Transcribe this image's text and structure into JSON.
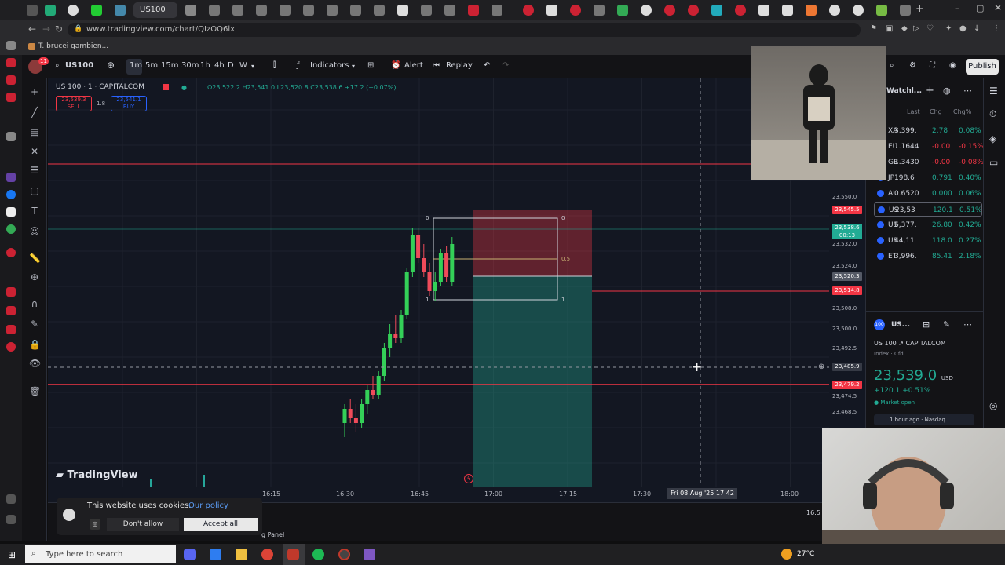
{
  "browser": {
    "active_tab": "US100",
    "url": "www.tradingview.com/chart/QIzOQ6lx",
    "bookmark": "T. brucei gambien..."
  },
  "header": {
    "avatar_badge": "11",
    "symbol": "US100",
    "intervals": [
      "1m",
      "5m",
      "15m",
      "30m",
      "1h",
      "4h",
      "D",
      "W"
    ],
    "indicators": "Indicators",
    "alert": "Alert",
    "replay": "Replay",
    "publish": "Publish"
  },
  "legend": {
    "title": "US 100 · 1 · CAPITALCOM",
    "ohlc": "O23,522.2 H23,541.0 L23,520.8 C23,538.6 +17.2 (+0.07%)",
    "sell_price": "23,539.3",
    "sell_label": "SELL",
    "spread": "1.8",
    "buy_price": "23,541.1",
    "buy_label": "BUY"
  },
  "chart": {
    "price_ticks": [
      "23,550.0",
      "23,532.0",
      "23,524.0",
      "23,508.0",
      "23,500.0",
      "23,492.5",
      "23,474.5",
      "23,468.5"
    ],
    "price_labels": [
      {
        "text": "23,545.5",
        "color": "#f23645"
      },
      {
        "text": "23,538.6",
        "color": "#22ab94"
      },
      {
        "text": "23,520.3",
        "color": "#555a66"
      },
      {
        "text": "23,514.8",
        "color": "#f23645"
      },
      {
        "text": "23,485.9",
        "color": "#363a45"
      },
      {
        "text": "23,479.2",
        "color": "#f23645"
      }
    ],
    "countdown": "00:13",
    "time_ticks": [
      "16:15",
      "16:30",
      "16:45",
      "17:00",
      "17:15",
      "17:30",
      "18:00"
    ],
    "crosshair_time": "Fri 08 Aug '25  17:42",
    "fib_top": "0",
    "fib_mid": "0.5",
    "fib_bottom": "1",
    "fib_top_left": "0",
    "fib_bottom_left": "1",
    "logo": "TradingView",
    "right_clock": "16:5"
  },
  "chart_data": {
    "type": "candlestick",
    "ylim": [
      23460,
      23560
    ],
    "candles": [
      {
        "o": 23462,
        "h": 23470,
        "l": 23456,
        "c": 23468
      },
      {
        "o": 23468,
        "h": 23472,
        "l": 23462,
        "c": 23464
      },
      {
        "o": 23464,
        "h": 23470,
        "l": 23458,
        "c": 23462
      },
      {
        "o": 23462,
        "h": 23472,
        "l": 23460,
        "c": 23470
      },
      {
        "o": 23470,
        "h": 23478,
        "l": 23466,
        "c": 23476
      },
      {
        "o": 23476,
        "h": 23482,
        "l": 23472,
        "c": 23474
      },
      {
        "o": 23474,
        "h": 23484,
        "l": 23472,
        "c": 23482
      },
      {
        "o": 23482,
        "h": 23496,
        "l": 23480,
        "c": 23494
      },
      {
        "o": 23494,
        "h": 23504,
        "l": 23490,
        "c": 23500
      },
      {
        "o": 23500,
        "h": 23508,
        "l": 23496,
        "c": 23498
      },
      {
        "o": 23498,
        "h": 23510,
        "l": 23496,
        "c": 23508
      },
      {
        "o": 23508,
        "h": 23528,
        "l": 23506,
        "c": 23526
      },
      {
        "o": 23526,
        "h": 23545,
        "l": 23524,
        "c": 23542
      },
      {
        "o": 23542,
        "h": 23545,
        "l": 23530,
        "c": 23532
      },
      {
        "o": 23532,
        "h": 23538,
        "l": 23524,
        "c": 23526
      },
      {
        "o": 23526,
        "h": 23530,
        "l": 23516,
        "c": 23518
      },
      {
        "o": 23518,
        "h": 23526,
        "l": 23514,
        "c": 23522
      },
      {
        "o": 23522,
        "h": 23536,
        "l": 23520,
        "c": 23534
      },
      {
        "o": 23534,
        "h": 23537,
        "l": 23522,
        "c": 23524
      },
      {
        "o": 23522,
        "h": 23541,
        "l": 23520,
        "c": 23538
      }
    ]
  },
  "watchlist": {
    "title": "Watchl...",
    "columns": [
      "Last",
      "Chg",
      "Chg%"
    ],
    "rows": [
      {
        "sym": "XA",
        "last": "3,399.",
        "chg": "2.78",
        "pct": "0.08%",
        "color": "#22ab94"
      },
      {
        "sym": "EU",
        "last": "1.1644",
        "chg": "-0.00",
        "pct": "-0.15%",
        "color": "#f23645"
      },
      {
        "sym": "GB",
        "last": "1.3430",
        "chg": "-0.00",
        "pct": "-0.08%",
        "color": "#f23645"
      },
      {
        "sym": "JP",
        "last": "198.6",
        "chg": "0.791",
        "pct": "0.40%",
        "color": "#22ab94"
      },
      {
        "sym": "AU",
        "last": "0.6520",
        "chg": "0.000",
        "pct": "0.06%",
        "color": "#22ab94"
      },
      {
        "sym": "US",
        "last": "23,53",
        "chg": "120.1",
        "pct": "0.51%",
        "color": "#22ab94"
      },
      {
        "sym": "US",
        "last": "6,377.",
        "chg": "26.80",
        "pct": "0.42%",
        "color": "#22ab94"
      },
      {
        "sym": "US",
        "last": "44,11",
        "chg": "118.0",
        "pct": "0.27%",
        "color": "#22ab94"
      },
      {
        "sym": "ET",
        "last": "3,996.",
        "chg": "85.41",
        "pct": "2.18%",
        "color": "#22ab94"
      }
    ]
  },
  "details": {
    "short": "US...",
    "name": "US 100",
    "exchange": "CAPITALCOM",
    "type": "Index · Cfd",
    "price": "23,539.0",
    "currency": "USD",
    "change": "+120.1",
    "change_pct": "+0.51%",
    "status": "Market open",
    "news": "1 hour ago · Nasdaq"
  },
  "cookie": {
    "text": "This website uses cookies.",
    "link": "Our policy",
    "deny": "Don't allow",
    "accept": "Accept all"
  },
  "bottom_panel": {
    "label": "g Panel"
  },
  "taskbar": {
    "search_placeholder": "Type here to search",
    "weather": "27°C"
  }
}
